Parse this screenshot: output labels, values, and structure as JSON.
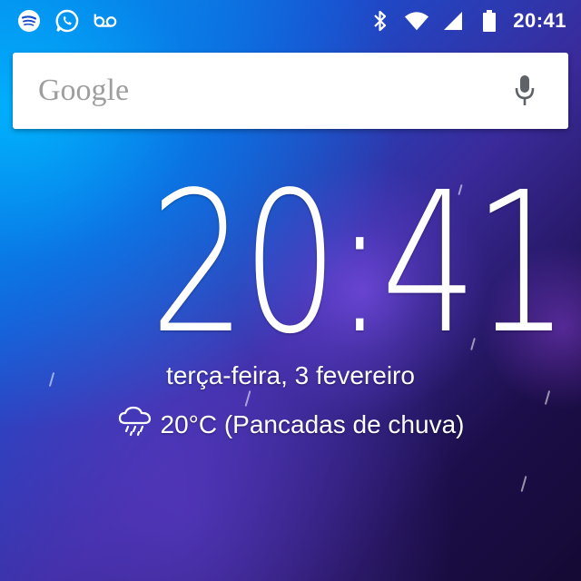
{
  "status_bar": {
    "notification_icons": [
      "spotify-icon",
      "whatsapp-icon",
      "voicemail-icon"
    ],
    "system_icons": [
      "bluetooth-icon",
      "wifi-icon",
      "signal-icon",
      "battery-icon"
    ],
    "time": "20:41"
  },
  "search": {
    "logo": "Google",
    "mic_icon": "mic-icon"
  },
  "clock_widget": {
    "time": "20:41",
    "date": "terça-feira, 3 fevereiro",
    "weather_icon": "rain-cloud-icon",
    "weather": "20°C (Pancadas de chuva)"
  },
  "colors": {
    "text": "#ffffff",
    "search_bg": "#ffffff",
    "logo_gray": "#9e9e9e",
    "mic_gray": "#5f6368"
  }
}
